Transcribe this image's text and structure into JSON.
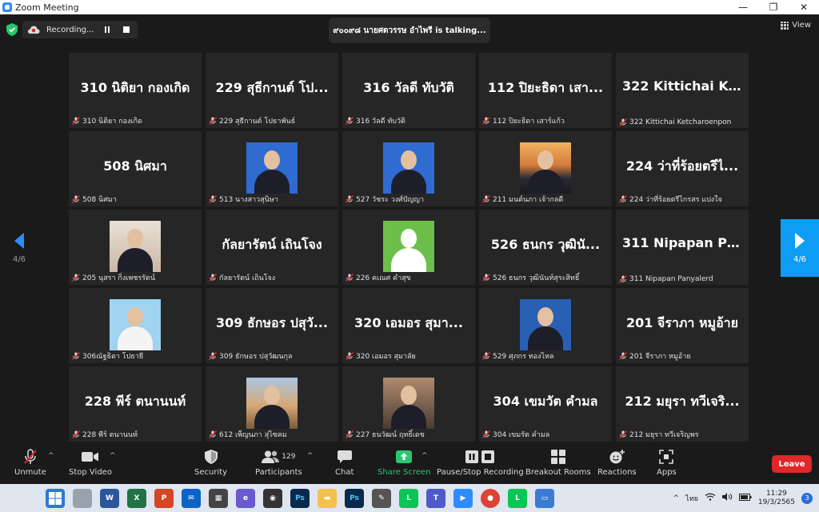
{
  "window": {
    "title": "Zoom Meeting",
    "controls": [
      "—",
      "❐",
      "✕"
    ]
  },
  "topbar": {
    "recording_label": "Recording...",
    "talking": "๙๐๐๙๘ นายศตวรรษ อำไพรี is talking...",
    "view_label": "View"
  },
  "paging": {
    "left_page": "4/6",
    "right_page": "4/6"
  },
  "tiles": [
    {
      "big": "310 นิติยา กองเกิด",
      "name": "310 นิติยา กองเกิด",
      "photo": ""
    },
    {
      "big": "229 สุธีกานต์ โป...",
      "name": "229 สุธีกานต์ โปธาพันธ์",
      "photo": ""
    },
    {
      "big": "316 วัลดี ทับวัติ",
      "name": "316 วัลดี ทับวัติ",
      "photo": ""
    },
    {
      "big": "112 ปิยะธิดา เสา...",
      "name": "112 ปิยะธิดา เสาร์แก้ว",
      "photo": ""
    },
    {
      "big": "322 Kittichai Ke...",
      "name": "322 Kittichai Ketcharoenpon",
      "photo": ""
    },
    {
      "big": "508 นิศมา",
      "name": "508 นิศมา",
      "photo": ""
    },
    {
      "big": "",
      "name": "513 นางสาวสุนิษา",
      "photo": "blue"
    },
    {
      "big": "",
      "name": "527 วัชระ วงศ์ปัญญา",
      "photo": "blue"
    },
    {
      "big": "",
      "name": "211 มนต์นภา เจ้ากลดี",
      "photo": "sunset"
    },
    {
      "big": "224 ว่าที่ร้อยตรีไ...",
      "name": "224 ว่าที่ร้อยตรีไกรสร แปงใจ",
      "photo": ""
    },
    {
      "big": "",
      "name": "205 นุสรา กิ่งเพชรรัตน์",
      "photo": "warm"
    },
    {
      "big": "กัลยารัตน์ เถินโจง",
      "name": "กัลยารัตน์ เถินโจง",
      "photo": ""
    },
    {
      "big": "",
      "name": "226 คเณศ คำสุข",
      "photo": "default"
    },
    {
      "big": "526 ธนกร วุฒินั...",
      "name": "526 ธนกร วุฒินันท์สุระสิทธิ์",
      "photo": ""
    },
    {
      "big": "311 Nipapan Pa...",
      "name": "311 Nipapan Panyalerd",
      "photo": ""
    },
    {
      "big": "",
      "name": "306ณัฐธิดา โปธายี",
      "photo": "light-blue"
    },
    {
      "big": "309 ธักษอร ปสุวั...",
      "name": "309 ธักษอร ปสุวัฒนกุล",
      "photo": ""
    },
    {
      "big": "320 เอมอร สุมา...",
      "name": "320 เอมอร สุมาลัย",
      "photo": ""
    },
    {
      "big": "",
      "name": "529 ศุภกร ทองไหล",
      "photo": "dark-blue"
    },
    {
      "big": "201 จีราภา หมูอ้าย",
      "name": "201 จีราภา หมูอ้าย",
      "photo": ""
    },
    {
      "big": "228 พีร์ ตนานนท์",
      "name": "228 พีร์ ตนานนท์",
      "photo": ""
    },
    {
      "big": "",
      "name": "612 เพ็ญนภา สุ่ไซคม",
      "photo": "field"
    },
    {
      "big": "",
      "name": "227 ธนวัฒน์ ฤทธิ์เดช",
      "photo": "street"
    },
    {
      "big": "304 เขมวัต คำมล",
      "name": "304 เขมรัต คำมล",
      "photo": ""
    },
    {
      "big": "212 มยุรา ทวีเจริ...",
      "name": "212 มยุรา ทวีเจริญพร",
      "photo": ""
    }
  ],
  "toolbar": {
    "unmute": "Unmute",
    "stop_video": "Stop Video",
    "security": "Security",
    "participants": "Participants",
    "participants_count": "129",
    "chat": "Chat",
    "share_screen": "Share Screen",
    "pause_stop_recording": "Pause/Stop Recording",
    "breakout_rooms": "Breakout Rooms",
    "reactions": "Reactions",
    "apps": "Apps",
    "leave": "Leave"
  },
  "taskbar": {
    "apps": [
      "windows-start-icon",
      "task-view-icon",
      "word-icon",
      "excel-icon",
      "powerpoint-icon",
      "mail-icon",
      "qr-app-icon",
      "ie-app-icon",
      "obs-icon",
      "photoshop-icon",
      "file-explorer-icon",
      "photoshop2-icon",
      "pen-app-icon",
      "line-icon",
      "teams-icon",
      "zoom-icon",
      "chrome-icon",
      "line2-icon",
      "monitor-app-icon"
    ],
    "language": "ไทย",
    "time": "11:29",
    "date": "19/3/2565",
    "notification_count": "3"
  },
  "colors": {
    "accent": "#2d8cff",
    "leave": "#e02828",
    "share": "#28c76f",
    "tile": "#262626"
  }
}
